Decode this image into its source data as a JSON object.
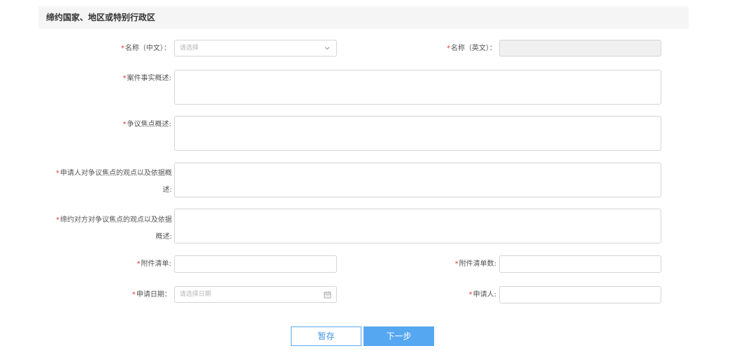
{
  "section": {
    "title": "缔约国家、地区或特别行政区"
  },
  "form": {
    "name_cn": {
      "required_mark": "*",
      "label": "名称（中文）",
      "colon": "：",
      "placeholder": "请选择"
    },
    "name_en": {
      "required_mark": "*",
      "label": "名称（英文）",
      "colon": "：",
      "value": ""
    },
    "case_facts": {
      "required_mark": "*",
      "label": "案件事实概述",
      "colon": ":"
    },
    "dispute_focus": {
      "required_mark": "*",
      "label": "争议焦点概述",
      "colon": ":"
    },
    "applicant_view": {
      "required_mark": "*",
      "label_line1": "申请人对争议焦点的观点以及依据概",
      "label_line2": "述",
      "colon": ":"
    },
    "counterparty_view": {
      "required_mark": "*",
      "label_line1": "缔约对方对争议焦点的观点以及依据",
      "label_line2": "概述",
      "colon": ":"
    },
    "attachment_list": {
      "required_mark": "*",
      "label": "附件清单",
      "colon": ":"
    },
    "attachment_count": {
      "required_mark": "*",
      "label": "附件清单数",
      "colon": ":"
    },
    "apply_date": {
      "required_mark": "*",
      "label": "申请日期",
      "colon": "：",
      "placeholder": "请选择日期"
    },
    "applicant": {
      "required_mark": "*",
      "label": "申请人",
      "colon": ":"
    }
  },
  "buttons": {
    "save": "暂存",
    "next": "下一步"
  },
  "icons": {
    "select": "chevron-down-icon",
    "date": "calendar-icon"
  }
}
